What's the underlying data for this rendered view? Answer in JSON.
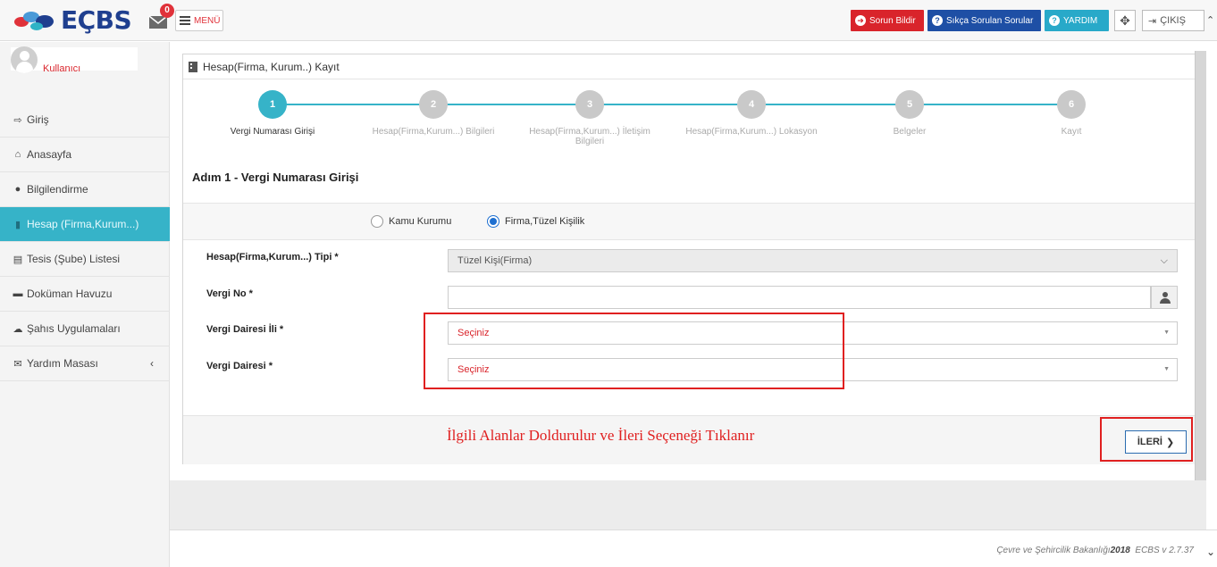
{
  "header": {
    "logo_text": "EÇBS",
    "mail_count": "0",
    "menu_label": "MENÜ",
    "report_label": "Sorun Bildir",
    "faq_label": "Sıkça Sorulan Sorular",
    "help_label": "YARDIM",
    "exit_label": "ÇIKIŞ"
  },
  "user": {
    "name": "Kullanıcı"
  },
  "sidebar": {
    "items": [
      {
        "label": "Giriş"
      },
      {
        "label": "Anasayfa"
      },
      {
        "label": "Bilgilendirme"
      },
      {
        "label": "Hesap (Firma,Kurum...)"
      },
      {
        "label": "Tesis (Şube) Listesi"
      },
      {
        "label": "Doküman Havuzu"
      },
      {
        "label": "Şahıs Uygulamaları"
      },
      {
        "label": "Yardım Masası"
      }
    ]
  },
  "panel": {
    "title": "Hesap(Firma, Kurum..) Kayıt",
    "steps": [
      {
        "num": "1",
        "label": "Vergi Numarası Girişi"
      },
      {
        "num": "2",
        "label": "Hesap(Firma,Kurum...) Bilgileri"
      },
      {
        "num": "3",
        "label": "Hesap(Firma,Kurum...) İletişim Bilgileri"
      },
      {
        "num": "4",
        "label": "Hesap(Firma,Kurum...) Lokasyon"
      },
      {
        "num": "5",
        "label": "Belgeler"
      },
      {
        "num": "6",
        "label": "Kayıt"
      }
    ],
    "active_step": 1,
    "step_title": "Adım 1 - Vergi Numarası Girişi",
    "radio_kamu": "Kamu Kurumu",
    "radio_firma": "Firma,Tüzel Kişilik",
    "radio_selected": "Firma,Tüzel Kişilik",
    "fields": {
      "tip_label": "Hesap(Firma,Kurum...) Tipi *",
      "tip_value": "Tüzel Kişi(Firma)",
      "vergi_no_label": "Vergi No *",
      "vergi_no_value": "",
      "vd_il_label": "Vergi Dairesi İli *",
      "vd_il_value": "Seçiniz",
      "vd_label": "Vergi Dairesi *",
      "vd_value": "Seçiniz"
    },
    "annotation": "İlgili Alanlar Doldurulur ve İleri Seçeneği Tıklanır",
    "next_label": "İLERİ"
  },
  "footer": {
    "ministry": "Çevre ve Şehircilik Bakanlığı",
    "year": "2018",
    "version": "ECBS v 2.7.37"
  },
  "colors": {
    "accent": "#36b3c8",
    "danger": "#d9242b",
    "primary": "#1e4fa5"
  }
}
